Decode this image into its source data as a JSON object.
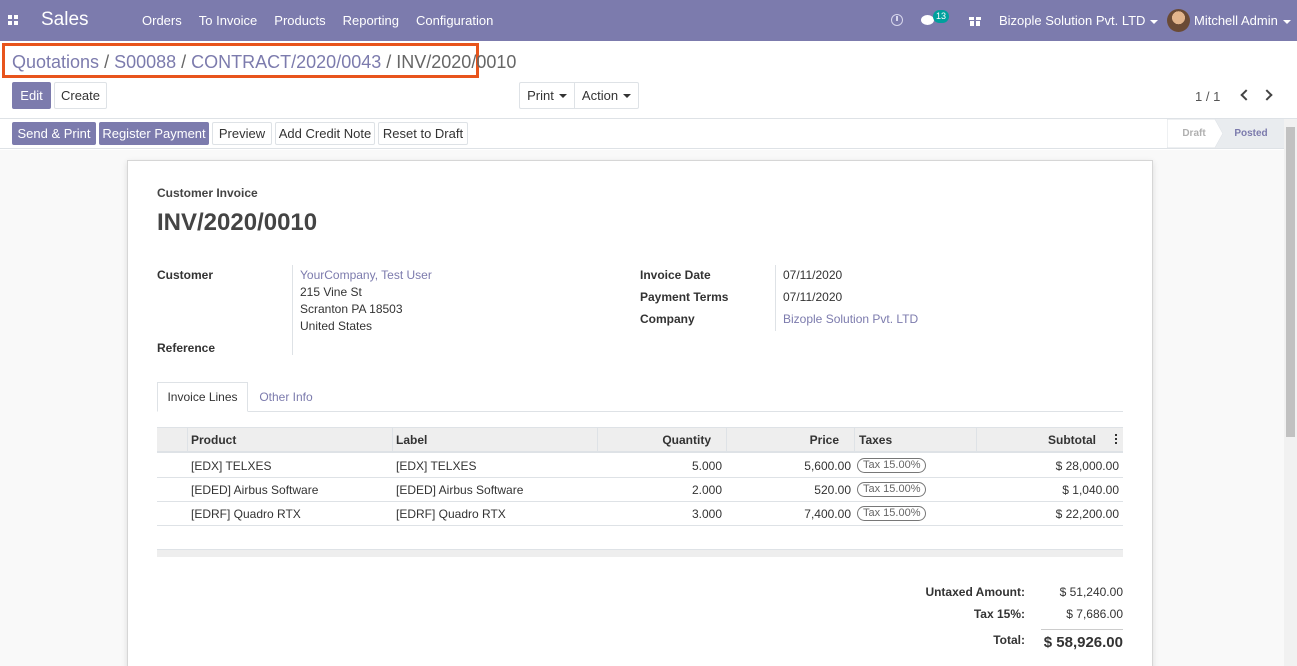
{
  "navbar": {
    "app_title": "Sales",
    "menu": [
      "Orders",
      "To Invoice",
      "Products",
      "Reporting",
      "Configuration"
    ],
    "chat_count": "13",
    "company": "Bizople Solution Pvt. LTD",
    "user": "Mitchell Admin",
    "accent_color": "#7c7bad"
  },
  "breadcrumb": {
    "items": [
      "Quotations",
      "S00088",
      "CONTRACT/2020/0043"
    ],
    "current": "INV/2020/0010",
    "separator": "/"
  },
  "toolbar": {
    "edit_label": "Edit",
    "create_label": "Create",
    "print_label": "Print",
    "action_label": "Action",
    "pager": "1 / 1"
  },
  "header_buttons": {
    "send_print": "Send & Print",
    "register_payment": "Register Payment",
    "preview": "Preview",
    "add_credit_note": "Add Credit Note",
    "reset_to_draft": "Reset to Draft"
  },
  "statusbar": {
    "stages": [
      "Draft",
      "Posted"
    ],
    "active": "Posted"
  },
  "invoice": {
    "doc_type": "Customer Invoice",
    "number": "INV/2020/0010",
    "customer_label": "Customer",
    "customer_name": "YourCompany, Test User",
    "address_1": "215 Vine St",
    "address_2": "Scranton PA 18503",
    "address_3": "United States",
    "reference_label": "Reference",
    "invoice_date_label": "Invoice Date",
    "invoice_date": "07/11/2020",
    "payment_terms_label": "Payment Terms",
    "payment_terms": "07/11/2020",
    "company_label": "Company",
    "company": "Bizople Solution Pvt. LTD"
  },
  "tabs": [
    "Invoice Lines",
    "Other Info"
  ],
  "lines": {
    "columns": [
      "Product",
      "Label",
      "Quantity",
      "Price",
      "Taxes",
      "Subtotal"
    ],
    "rows": [
      {
        "product": "[EDX] TELXES",
        "label": "[EDX] TELXES",
        "quantity": "5.000",
        "price": "5,600.00",
        "tax": "Tax 15.00%",
        "subtotal": "$ 28,000.00"
      },
      {
        "product": "[EDED] Airbus Software",
        "label": "[EDED] Airbus Software",
        "quantity": "2.000",
        "price": "520.00",
        "tax": "Tax 15.00%",
        "subtotal": "$ 1,040.00"
      },
      {
        "product": "[EDRF] Quadro RTX",
        "label": "[EDRF] Quadro RTX",
        "quantity": "3.000",
        "price": "7,400.00",
        "tax": "Tax 15.00%",
        "subtotal": "$ 22,200.00"
      }
    ]
  },
  "totals": {
    "untaxed_label": "Untaxed Amount:",
    "untaxed": "$ 51,240.00",
    "tax_label": "Tax 15%:",
    "tax": "$ 7,686.00",
    "total_label": "Total:",
    "total": "$ 58,926.00"
  }
}
